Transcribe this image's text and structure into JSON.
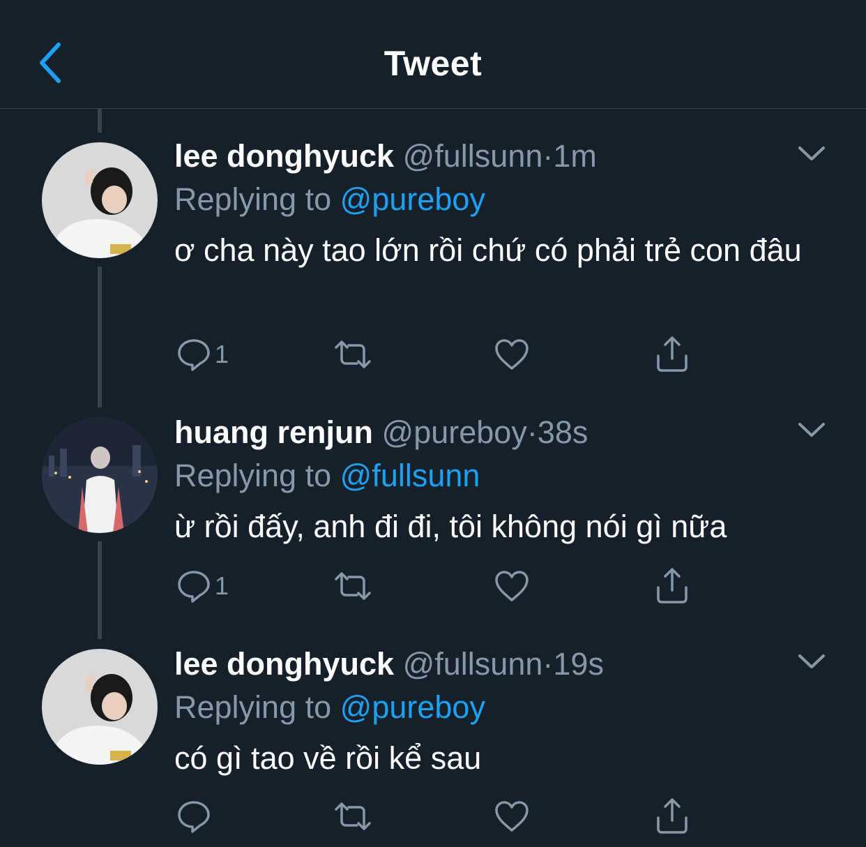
{
  "header": {
    "title": "Tweet"
  },
  "colors": {
    "background": "#15202b",
    "secondary_text": "#8899a6",
    "accent": "#1da1f2",
    "divider": "#38444d"
  },
  "tweets": [
    {
      "name": "lee donghyuck",
      "handle": "@fullsunn",
      "dot": "·",
      "time": "1m",
      "replying_prefix": "Replying to",
      "replying_to": "@pureboy",
      "text": "ơ cha này tao lớn rồi chứ có phải trẻ con đâu",
      "reply_count": "1"
    },
    {
      "name": "huang renjun",
      "handle": "@pureboy",
      "dot": "·",
      "time": "38s",
      "replying_prefix": "Replying to",
      "replying_to": "@fullsunn",
      "text": "ừ rồi đấy, anh đi đi, tôi không nói gì nữa",
      "reply_count": "1"
    },
    {
      "name": "lee donghyuck",
      "handle": "@fullsunn",
      "dot": "·",
      "time": "19s",
      "replying_prefix": "Replying to",
      "replying_to": "@pureboy",
      "text": "có gì tao về rồi kể sau",
      "reply_count": ""
    }
  ]
}
